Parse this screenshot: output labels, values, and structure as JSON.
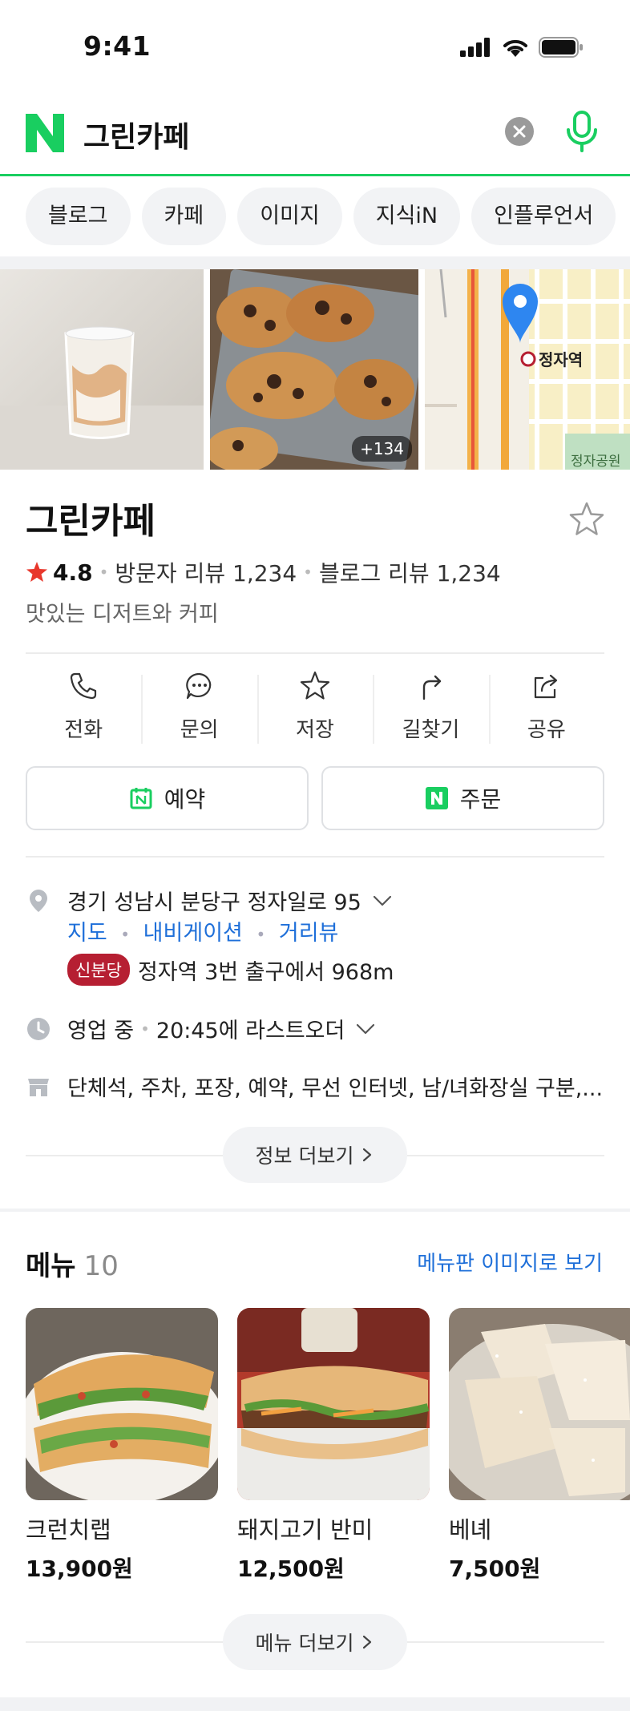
{
  "status": {
    "time": "9:41"
  },
  "search": {
    "query": "그린카페",
    "logo_letter": "N"
  },
  "chips": [
    "블로그",
    "카페",
    "이미지",
    "지식iN",
    "인플루언서"
  ],
  "photos": {
    "more_count": "+134",
    "map_station": "정자역",
    "map_park": "정자공원"
  },
  "place": {
    "name": "그린카페",
    "rating": "4.8",
    "visitor_reviews": "방문자 리뷰 1,234",
    "blog_reviews": "블로그 리뷰 1,234",
    "tagline": "맛있는 디저트와 커피"
  },
  "actions": [
    {
      "label": "전화",
      "icon": "phone-icon"
    },
    {
      "label": "문의",
      "icon": "chat-icon"
    },
    {
      "label": "저장",
      "icon": "star-icon"
    },
    {
      "label": "길찾기",
      "icon": "directions-icon"
    },
    {
      "label": "공유",
      "icon": "share-icon"
    }
  ],
  "buttons": {
    "reserve": "예약",
    "order": "주문",
    "order_logo": "N"
  },
  "info": {
    "address": "경기 성남시 분당구 정자일로 95",
    "links": [
      "지도",
      "내비게이션",
      "거리뷰"
    ],
    "subway_badge": "신분당",
    "subway_text": "정자역 3번 출구에서 968m",
    "hours_status": "영업 중",
    "hours_text": "20:45에 라스트오더",
    "amenities": "단체석, 주차, 포장, 예약, 무선 인터넷, 남/녀화장실 구분,...",
    "more_info": "정보 더보기"
  },
  "menu": {
    "title": "메뉴",
    "count": "10",
    "image_link": "메뉴판 이미지로 보기",
    "items": [
      {
        "name": "크런치랩",
        "price": "13,900원"
      },
      {
        "name": "돼지고기 반미",
        "price": "12,500원"
      },
      {
        "name": "베녜",
        "price": "7,500원"
      }
    ],
    "more": "메뉴 더보기"
  },
  "colors": {
    "naver_green": "#19ce60",
    "link_blue": "#1e6fd9",
    "star_red": "#e8372c",
    "subway_red": "#b61f32"
  }
}
